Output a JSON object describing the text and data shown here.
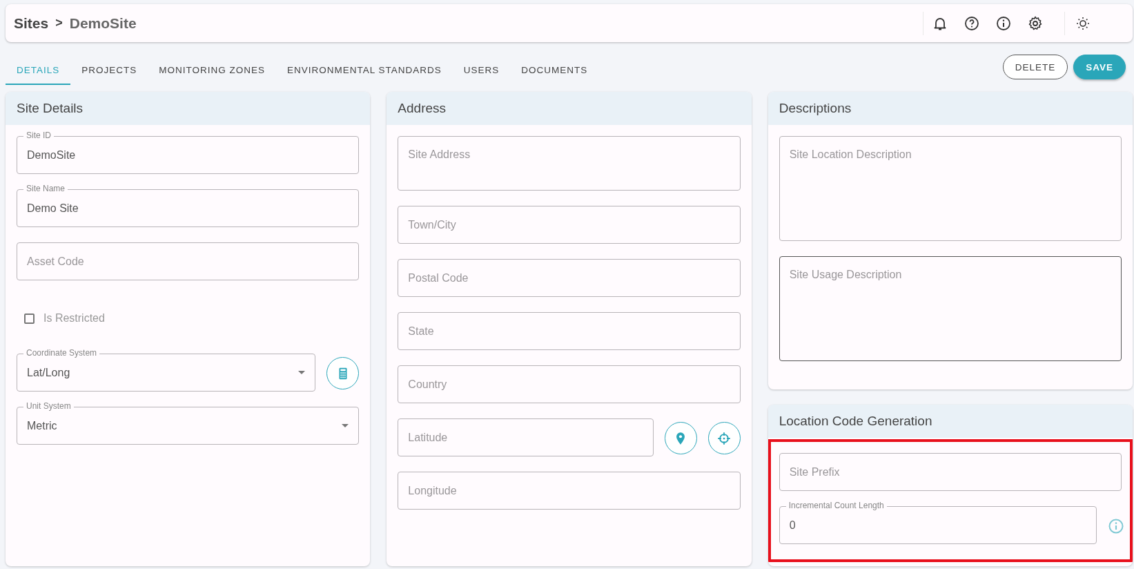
{
  "breadcrumb": {
    "parent": "Sites",
    "separator": ">",
    "current": "DemoSite"
  },
  "tabs": [
    {
      "label": "DETAILS",
      "selected": true
    },
    {
      "label": "PROJECTS",
      "selected": false
    },
    {
      "label": "MONITORING ZONES",
      "selected": false
    },
    {
      "label": "ENVIRONMENTAL STANDARDS",
      "selected": false
    },
    {
      "label": "USERS",
      "selected": false
    },
    {
      "label": "DOCUMENTS",
      "selected": false
    }
  ],
  "actions": [
    {
      "label": "DELETE",
      "kind": "outline"
    },
    {
      "label": "SAVE",
      "kind": "filled"
    }
  ],
  "columns": [
    [
      {
        "title": "Site Details",
        "highlighted": false,
        "fields": [
          {
            "kind": "text",
            "label": "Site ID",
            "value": "DemoSite"
          },
          {
            "kind": "text",
            "label": "Site Name",
            "value": "Demo Site"
          },
          {
            "kind": "text",
            "placeholder": "Asset Code"
          },
          {
            "kind": "checkbox",
            "label": "Is Restricted",
            "checked": false
          },
          {
            "kind": "select",
            "label": "Coordinate System",
            "value": "Lat/Long",
            "buttons": [
              {
                "kind": "calculator"
              }
            ]
          },
          {
            "kind": "select",
            "label": "Unit System",
            "value": "Metric"
          }
        ]
      }
    ],
    [
      {
        "title": "Address",
        "highlighted": false,
        "fields": [
          {
            "kind": "textarea",
            "placeholder": "Site Address"
          },
          {
            "kind": "text",
            "placeholder": "Town/City"
          },
          {
            "kind": "text",
            "placeholder": "Postal Code"
          },
          {
            "kind": "text",
            "placeholder": "State"
          },
          {
            "kind": "text",
            "placeholder": "Country"
          },
          {
            "kind": "text",
            "placeholder": "Latitude",
            "buttons": [
              {
                "kind": "pin"
              },
              {
                "kind": "target"
              }
            ]
          },
          {
            "kind": "text",
            "placeholder": "Longitude"
          }
        ]
      }
    ],
    [
      {
        "title": "Descriptions",
        "highlighted": false,
        "fields": [
          {
            "kind": "textarea",
            "placeholder": "Site Location Description",
            "focused": false
          },
          {
            "kind": "textarea",
            "placeholder": "Site Usage Description",
            "focused": true
          }
        ]
      },
      {
        "title": "Location Code Generation",
        "highlighted": true,
        "fields": [
          {
            "kind": "text",
            "placeholder": "Site Prefix"
          },
          {
            "kind": "text",
            "label": "Incremental Count Length",
            "value": "0",
            "buttons": [
              {
                "kind": "info"
              }
            ]
          }
        ]
      }
    ]
  ]
}
